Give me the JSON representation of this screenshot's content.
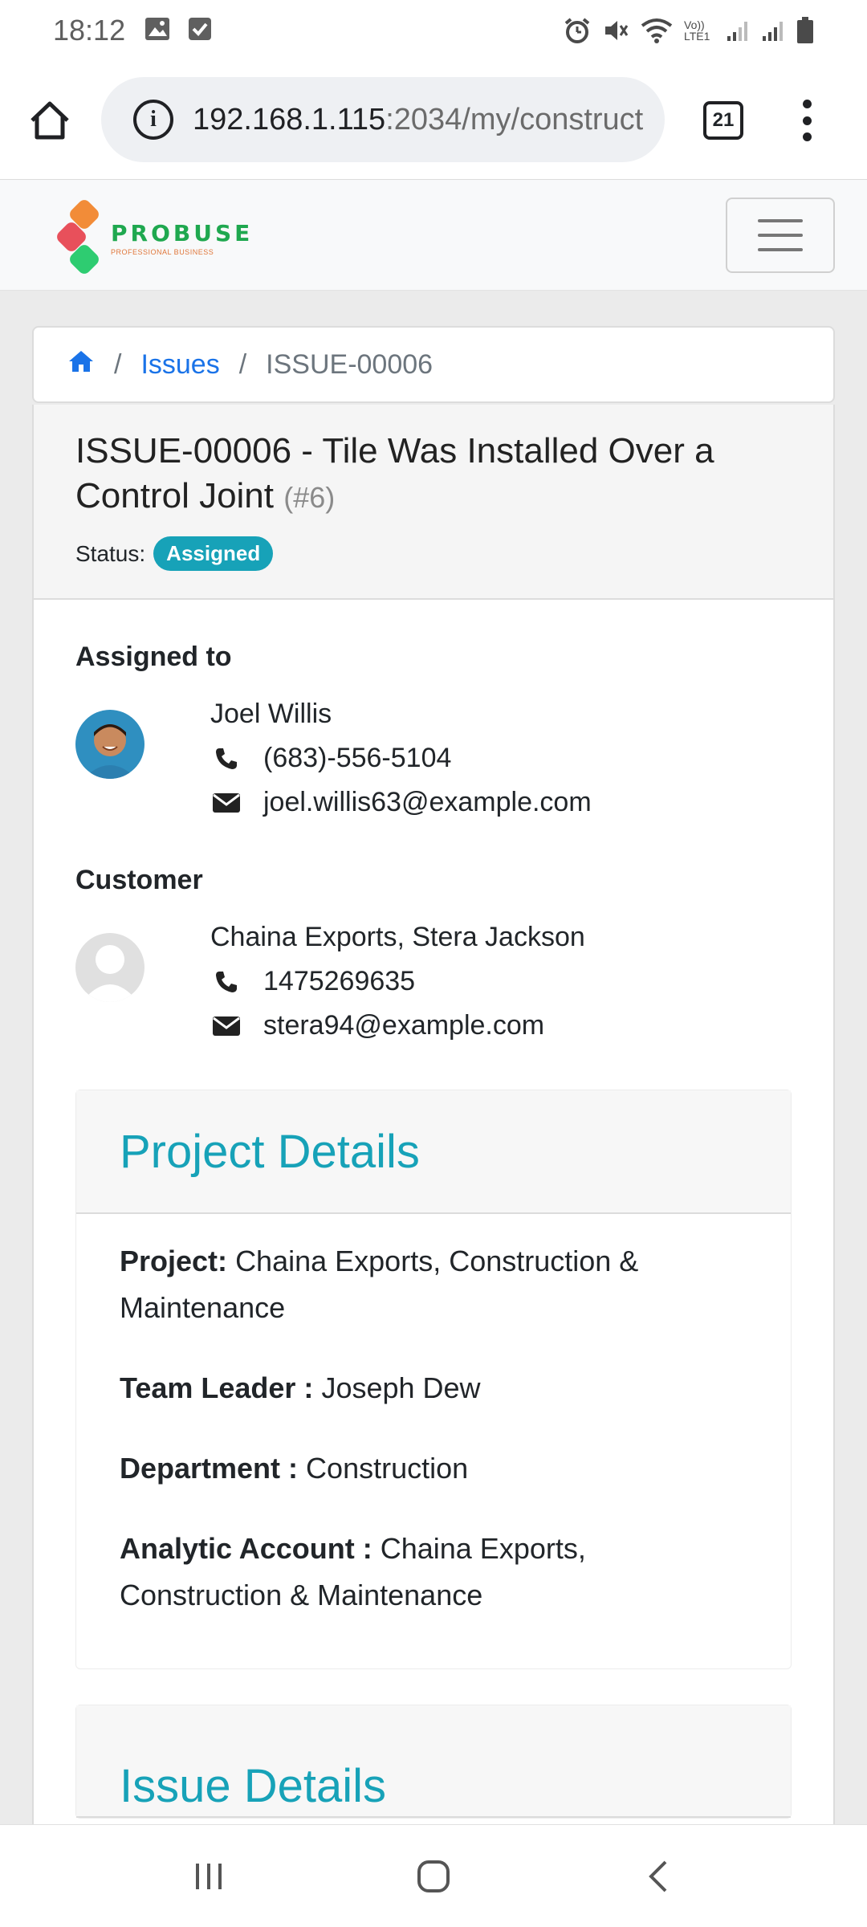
{
  "status_bar": {
    "time": "18:12",
    "network_label": "Vo)) LTE1"
  },
  "browser": {
    "url_host": "192.168.1.115",
    "url_rest": ":2034/my/construct",
    "tab_count": "21"
  },
  "site": {
    "logo_name": "PROBUSE",
    "logo_tagline": "PROFESSIONAL BUSINESS"
  },
  "breadcrumb": {
    "home_icon": "home-icon",
    "issues": "Issues",
    "current": "ISSUE-00006",
    "separator": "/"
  },
  "issue": {
    "title": "ISSUE-00006 - Tile Was Installed Over a Control Joint",
    "number": "(#6)",
    "status_label": "Status:",
    "status_value": "Assigned",
    "status_color": "#17a2b8"
  },
  "assigned": {
    "heading": "Assigned to",
    "name": "Joel Willis",
    "phone": "(683)-556-5104",
    "email": "joel.willis63@example.com"
  },
  "customer": {
    "heading": "Customer",
    "name": "Chaina Exports, Stera Jackson",
    "phone": "1475269635",
    "email": "stera94@example.com"
  },
  "project_details": {
    "heading": "Project Details",
    "project_label": "Project:",
    "project_value": "Chaina Exports, Construction & Maintenance",
    "team_leader_label": "Team Leader :",
    "team_leader_value": "Joseph Dew",
    "department_label": "Department :",
    "department_value": "Construction",
    "analytic_label": "Analytic Account :",
    "analytic_value": "Chaina Exports, Construction & Maintenance"
  },
  "issue_details": {
    "heading": "Issue Details"
  },
  "colors": {
    "accent": "#17a2b8",
    "link": "#1a73e8"
  }
}
